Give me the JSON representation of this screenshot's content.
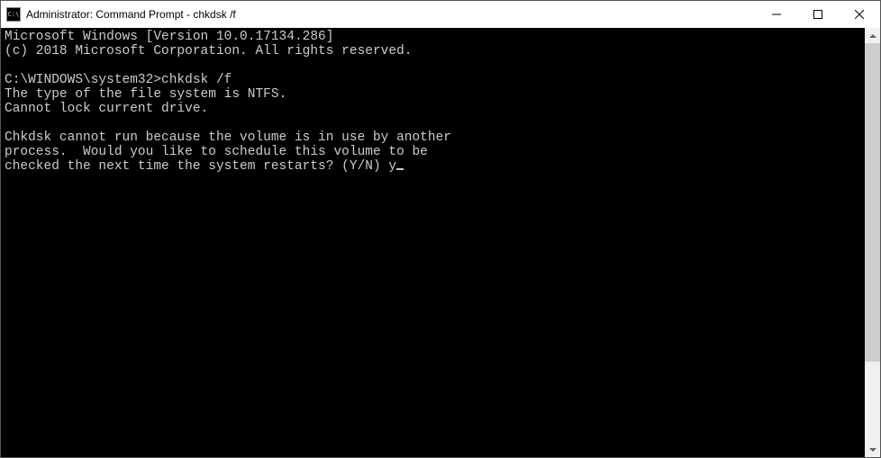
{
  "titlebar": {
    "icon_label": "C:\\",
    "title": "Administrator: Command Prompt - chkdsk  /f"
  },
  "terminal": {
    "line1": "Microsoft Windows [Version 10.0.17134.286]",
    "line2": "(c) 2018 Microsoft Corporation. All rights reserved.",
    "blank1": "",
    "prompt_line": "C:\\WINDOWS\\system32>chkdsk /f",
    "line3": "The type of the file system is NTFS.",
    "line4": "Cannot lock current drive.",
    "blank2": "",
    "line5": "Chkdsk cannot run because the volume is in use by another",
    "line6": "process.  Would you like to schedule this volume to be",
    "line7": "checked the next time the system restarts? (Y/N) y"
  }
}
